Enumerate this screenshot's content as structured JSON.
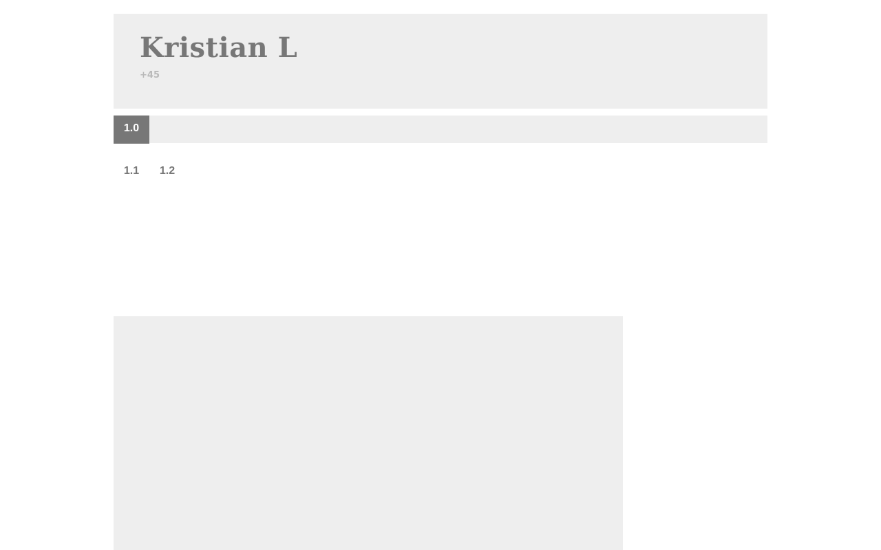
{
  "header": {
    "title": "Kristian L",
    "phone": "+45"
  },
  "nav": {
    "tabs": [
      {
        "label": "1.0",
        "active": true
      }
    ],
    "subtabs": [
      {
        "label": "1.1"
      },
      {
        "label": "1.2"
      }
    ]
  },
  "colors": {
    "panel_bg": "#eeeeee",
    "active_tab_bg": "#777777",
    "text_gray": "#777777",
    "muted_text": "#b9b9b9"
  }
}
